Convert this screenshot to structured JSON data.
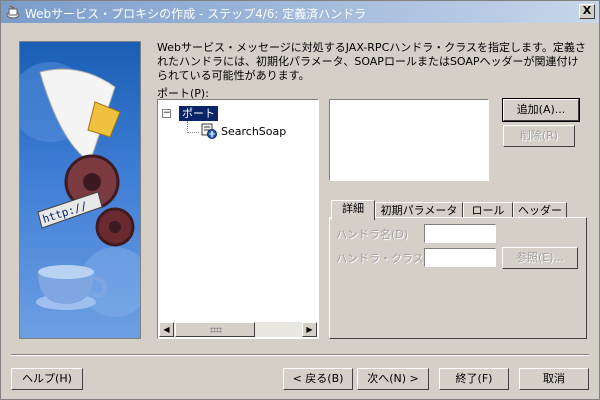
{
  "window": {
    "title": "Webサービス・プロキシの作成 - ステップ4/6: 定義済ハンドラ",
    "close_label": "X"
  },
  "description": "Webサービス・メッセージに対処するJAX-RPCハンドラ・クラスを指定します。定義されたハンドラには、初期化パラメータ、SOAPロールまたはSOAPヘッダーが関連付けられている可能性があります。",
  "port_label": "ポート(P):",
  "tree": {
    "expander": "−",
    "root": "ポート",
    "child": "SearchSoap"
  },
  "scrollbar": {
    "left_arrow": "◀",
    "right_arrow": "▶"
  },
  "buttons": {
    "add": "追加(A)...",
    "remove": "削除(R)",
    "browse": "参照(E)...",
    "help": "ヘルプ(H)",
    "back": "< 戻る(B)",
    "next": "次へ(N) >",
    "finish": "終了(F)",
    "cancel": "取消"
  },
  "tabs": [
    {
      "label": "詳細"
    },
    {
      "label": "初期パラメータ"
    },
    {
      "label": "ロール"
    },
    {
      "label": "ヘッダー"
    }
  ],
  "fields": {
    "handler_name": {
      "label": "ハンドラ名(D)",
      "value": ""
    },
    "handler_class": {
      "label": "ハンドラ・クラス(C)",
      "value": ""
    }
  },
  "art": {
    "banner_text": "http://"
  },
  "colors": {
    "dialog_bg": "#d4d0c8",
    "title_start": "#7a9ccb",
    "title_end": "#c7d6ea",
    "selection": "#0a246a"
  }
}
